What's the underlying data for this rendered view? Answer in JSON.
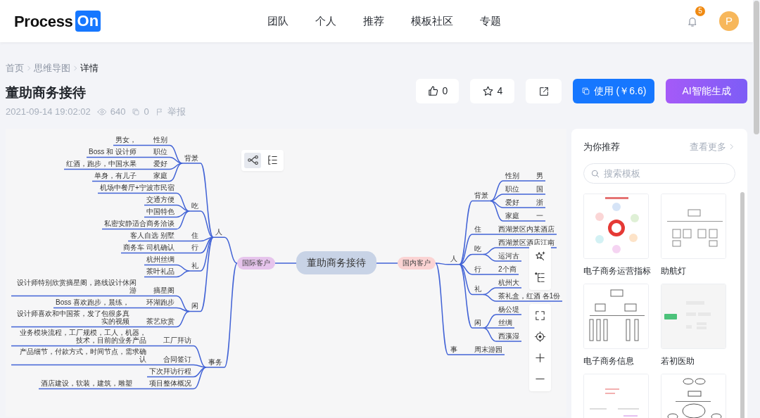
{
  "header": {
    "logo": {
      "text": "Process",
      "badge": "On"
    },
    "nav": [
      "团队",
      "个人",
      "推荐",
      "模板社区",
      "专题"
    ],
    "notifications": "5",
    "avatar": "P"
  },
  "breadcrumb": [
    "首页",
    "思维导图",
    "详情"
  ],
  "title": "董助商务接待",
  "meta": {
    "date": "2021-09-14 19:02:02",
    "views": "640",
    "copies": "0",
    "report": "举报"
  },
  "actions": {
    "likes": "0",
    "stars": "4",
    "use_button": "使用 (￥6.6)",
    "ai_button": "AI智能生成"
  },
  "mindmap": {
    "view_modes": [
      {
        "kind": "mindmap",
        "selected": true
      },
      {
        "kind": "outline",
        "selected": false
      }
    ],
    "root": "董助商务接待",
    "left": [
      {
        "label": "国际客户",
        "color": "#e6c4ec",
        "children": [
          {
            "label": "人",
            "children": [
              {
                "label": "背景",
                "children": [
                  {
                    "label": "性别",
                    "children": [
                      {
                        "label": "男女，"
                      }
                    ]
                  },
                  {
                    "label": "职位",
                    "children": [
                      {
                        "label": "Boss 和 设计师"
                      }
                    ]
                  },
                  {
                    "label": "爱好",
                    "children": [
                      {
                        "label": "红酒，跑步，中国水果"
                      }
                    ]
                  },
                  {
                    "label": "家庭",
                    "children": [
                      {
                        "label": "单身，有儿子"
                      }
                    ]
                  }
                ]
              },
              {
                "label": "吃",
                "children": [
                  {
                    "label": "机场中餐厅+宁波市民宿"
                  },
                  {
                    "label": "交通方便"
                  },
                  {
                    "label": "中国特色"
                  },
                  {
                    "label": "私密安静适合商务洽谈"
                  }
                ]
              },
              {
                "label": "住",
                "children": [
                  {
                    "label": "客人自选 别墅"
                  }
                ]
              },
              {
                "label": "行",
                "children": [
                  {
                    "label": "商务车 司机确认"
                  }
                ]
              },
              {
                "label": "礼",
                "children": [
                  {
                    "label": "杭州丝绸"
                  },
                  {
                    "label": "茶叶礼品"
                  }
                ]
              },
              {
                "label": "闲",
                "children": [
                  {
                    "label": "摘星阁",
                    "children": [
                      {
                        "label": "设计师特别欣赏摘星阁，路线设计休闲游"
                      }
                    ]
                  },
                  {
                    "label": "环湖跑步",
                    "children": [
                      {
                        "label": "Boss 喜欢跑步，晨练，"
                      }
                    ]
                  },
                  {
                    "label": "茶艺欣赏",
                    "children": [
                      {
                        "label": "设计师喜欢和中国茶，发了包很多真实的视频"
                      }
                    ]
                  }
                ]
              }
            ]
          },
          {
            "label": "事务",
            "children": [
              {
                "label": "工厂拜访",
                "children": [
                  {
                    "label": "业务模块流程，工厂规模，工人，机器，技术，目前的业务产品"
                  }
                ]
              },
              {
                "label": "合同签订",
                "children": [
                  {
                    "label": "产品细节，付款方式，时间节点，需求确认"
                  }
                ]
              },
              {
                "label": "下次拜访行程"
              },
              {
                "label": "项目整体概况",
                "children": [
                  {
                    "label": "酒店建设，软装，建筑，雕塑"
                  }
                ]
              }
            ]
          }
        ]
      }
    ],
    "right": [
      {
        "label": "国内客户",
        "color": "#fbd3d3",
        "children": [
          {
            "label": "人",
            "children": [
              {
                "label": "背景",
                "children": [
                  {
                    "label": "性别",
                    "children": [
                      {
                        "label": "男"
                      }
                    ]
                  },
                  {
                    "label": "职位",
                    "children": [
                      {
                        "label": "国"
                      }
                    ]
                  },
                  {
                    "label": "爱好",
                    "children": [
                      {
                        "label": "浙"
                      }
                    ]
                  },
                  {
                    "label": "家庭",
                    "children": [
                      {
                        "label": "一"
                      }
                    ]
                  }
                ]
              },
              {
                "label": "住",
                "children": [
                  {
                    "label": "西湖景区内某酒店"
                  }
                ]
              },
              {
                "label": "吃",
                "children": [
                  {
                    "label": "西湖景区酒店江南"
                  },
                  {
                    "label": "运河古"
                  }
                ]
              },
              {
                "label": "行",
                "children": [
                  {
                    "label": "2个商"
                  }
                ]
              },
              {
                "label": "礼",
                "children": [
                  {
                    "label": "杭州大"
                  },
                  {
                    "label": "茶礼盒，红酒 各1份"
                  }
                ]
              },
              {
                "label": "闲",
                "children": [
                  {
                    "label": "杨公堤"
                  },
                  {
                    "label": "丝绸"
                  },
                  {
                    "label": "西溪湿"
                  }
                ]
              }
            ]
          },
          {
            "label": "事",
            "children": [
              {
                "label": "周末游园"
              }
            ]
          }
        ]
      }
    ]
  },
  "recommend": {
    "title": "为你推荐",
    "more": "查看更多",
    "search": {
      "placeholder": "搜索模板"
    },
    "items": [
      {
        "kind": "template",
        "name": "电子商务运营指标"
      },
      {
        "kind": "template",
        "name": "助航灯"
      },
      {
        "kind": "template",
        "name": "电子商务信息"
      },
      {
        "kind": "template",
        "name": "若初医助"
      },
      {
        "kind": "template"
      },
      {
        "kind": "template"
      }
    ]
  }
}
